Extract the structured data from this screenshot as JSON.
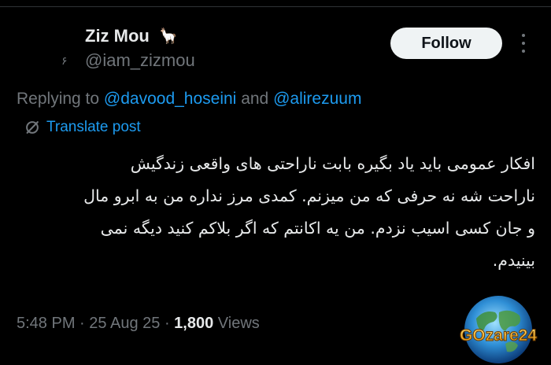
{
  "tweet": {
    "display_name": "Ziz Mou",
    "name_emoji": "🦙",
    "handle": "@iam_zizmou",
    "avatar_mark": "۶",
    "follow_label": "Follow",
    "replying_prefix": "Replying to",
    "reply_mention_1": "@davood_hoseini",
    "reply_and": "and",
    "reply_mention_2": "@alirezuum",
    "translate_label": "Translate post",
    "text_lines": [
      "افکار عمومی باید یاد بگیره بابت ناراحتی های واقعی زندگیش",
      "ناراحت شه نه حرفی که من میزنم.  کمدی مرز نداره من به ابرو مال",
      "و جان کسی اسیب نزدم. من یه اکانتم که اگر بلاکم کنید دیگه نمی",
      "بینیدم."
    ],
    "time": "5:48 PM",
    "separator": "·",
    "date": "25 Aug 25",
    "views_count": "1,800",
    "views_label": "Views"
  },
  "watermark": {
    "text": "GOzare24"
  },
  "colors": {
    "background": "#000000",
    "text_primary": "#e7e9ea",
    "text_secondary": "#71767b",
    "link": "#1d9bf0",
    "follow_bg": "#eff3f4",
    "divider": "#2f3336"
  }
}
